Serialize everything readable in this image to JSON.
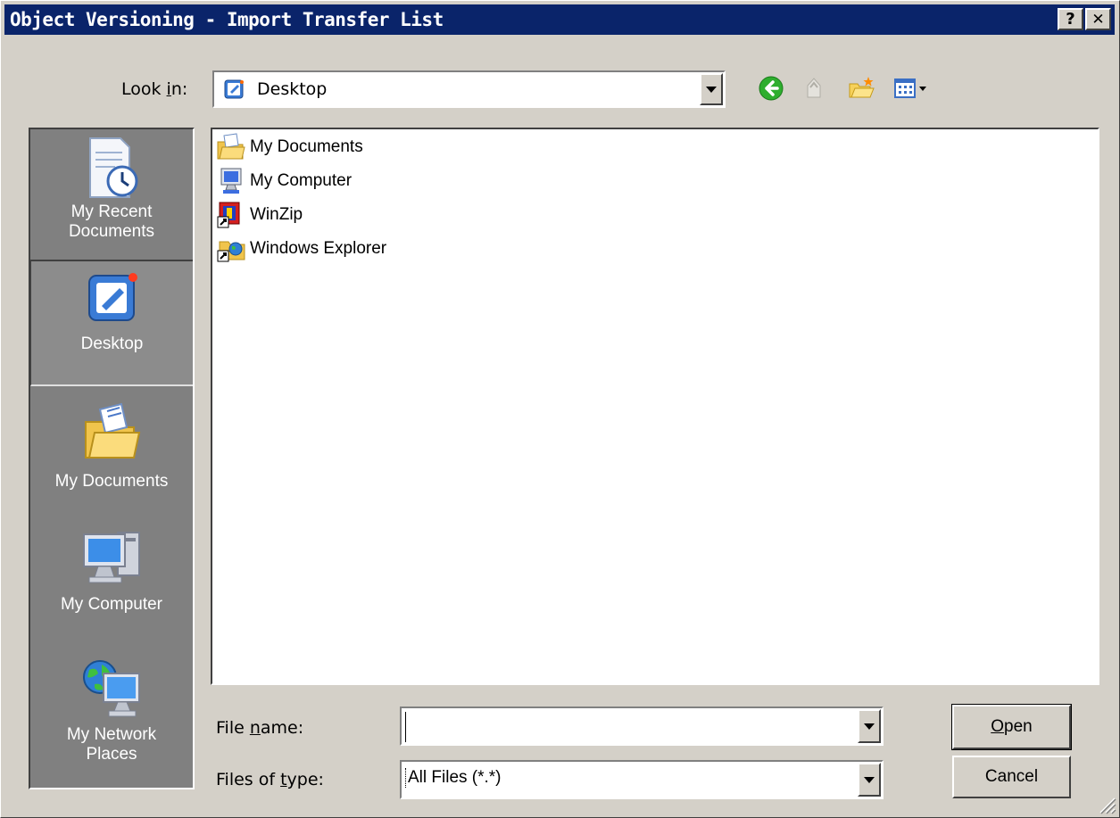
{
  "window": {
    "title": "Object Versioning - Import Transfer List",
    "help_glyph": "?",
    "close_glyph": "✕"
  },
  "lookin": {
    "label_pre": "Look ",
    "label_accel": "i",
    "label_post": "n:",
    "value": "Desktop"
  },
  "places": [
    {
      "label_line1": "My Recent",
      "label_line2": "Documents",
      "icon": "recent-documents-icon"
    },
    {
      "label_line1": "Desktop",
      "label_line2": "",
      "icon": "desktop-icon"
    },
    {
      "label_line1": "My Documents",
      "label_line2": "",
      "icon": "my-documents-icon"
    },
    {
      "label_line1": "My Computer",
      "label_line2": "",
      "icon": "my-computer-icon"
    },
    {
      "label_line1": "My Network",
      "label_line2": "Places",
      "icon": "network-places-icon"
    }
  ],
  "files": [
    {
      "name": "My Documents",
      "icon": "folder-documents-icon"
    },
    {
      "name": "My Computer",
      "icon": "computer-icon"
    },
    {
      "name": "WinZip",
      "icon": "winzip-icon"
    },
    {
      "name": "Windows Explorer",
      "icon": "explorer-icon"
    }
  ],
  "filename": {
    "label_pre": "File ",
    "label_accel": "n",
    "label_post": "ame:",
    "value": ""
  },
  "filetype": {
    "label_pre": "Files of ",
    "label_accel": "t",
    "label_post": "ype:",
    "value": "All Files (*.*)"
  },
  "buttons": {
    "open_accel": "O",
    "open_rest": "pen",
    "cancel": "Cancel"
  },
  "colors": {
    "titlebar": "#0a246a",
    "face": "#d4d0c8",
    "places_bg": "#808080"
  }
}
